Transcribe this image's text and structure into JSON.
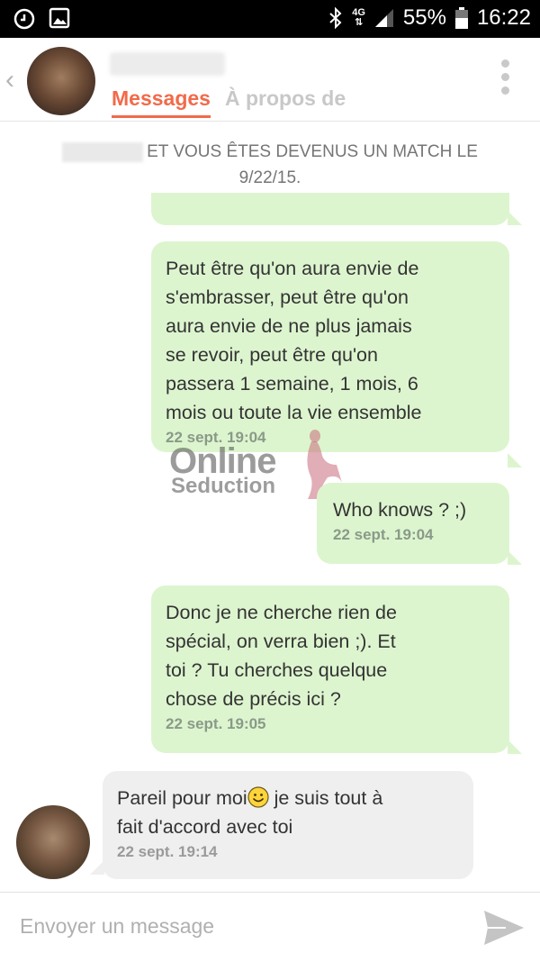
{
  "status_bar": {
    "network": "4G",
    "battery": "55%",
    "time": "16:22"
  },
  "header": {
    "tabs": [
      {
        "label": "Messages",
        "active": true
      },
      {
        "label": "À propos de",
        "active": false
      }
    ]
  },
  "match_notice": {
    "line1": "ET VOUS ÊTES DEVENUS UN MATCH LE",
    "line2": "9/22/15."
  },
  "messages": [
    {
      "direction": "sent",
      "lines": [
        "Peut être qu'on aura envie de",
        "s'embrasser, peut être qu'on",
        "aura envie de ne plus jamais",
        "se revoir, peut être qu'on",
        "passera 1 semaine, 1 mois, 6",
        "mois ou toute la vie ensemble"
      ],
      "time": "22 sept. 19:04"
    },
    {
      "direction": "sent",
      "lines": [
        "Who knows ? ;)"
      ],
      "time": "22 sept. 19:04"
    },
    {
      "direction": "sent",
      "lines": [
        "Donc je ne cherche rien de",
        "spécial, on verra bien ;). Et",
        "toi ? Tu cherches quelque",
        "chose de précis ici ?"
      ],
      "time": "22 sept. 19:05"
    },
    {
      "direction": "received",
      "line1_before_emoji": "Pareil pour moi",
      "line1_after_emoji": " je suis tout à",
      "line2": "fait d'accord avec toi",
      "time": "22 sept. 19:14"
    }
  ],
  "watermark": {
    "brand_top": "Online",
    "brand_bottom": "Seduction"
  },
  "composer": {
    "placeholder": "Envoyer un message"
  },
  "colors": {
    "accent": "#f26a4a",
    "sent_bubble": "#ddf5cf",
    "received_bubble": "#efefef"
  },
  "icons": [
    "alarm-icon",
    "image-icon",
    "bluetooth-icon",
    "signal-icon",
    "battery-icon",
    "back-chevron-icon",
    "more-vert-icon",
    "smiley-icon",
    "send-icon"
  ]
}
